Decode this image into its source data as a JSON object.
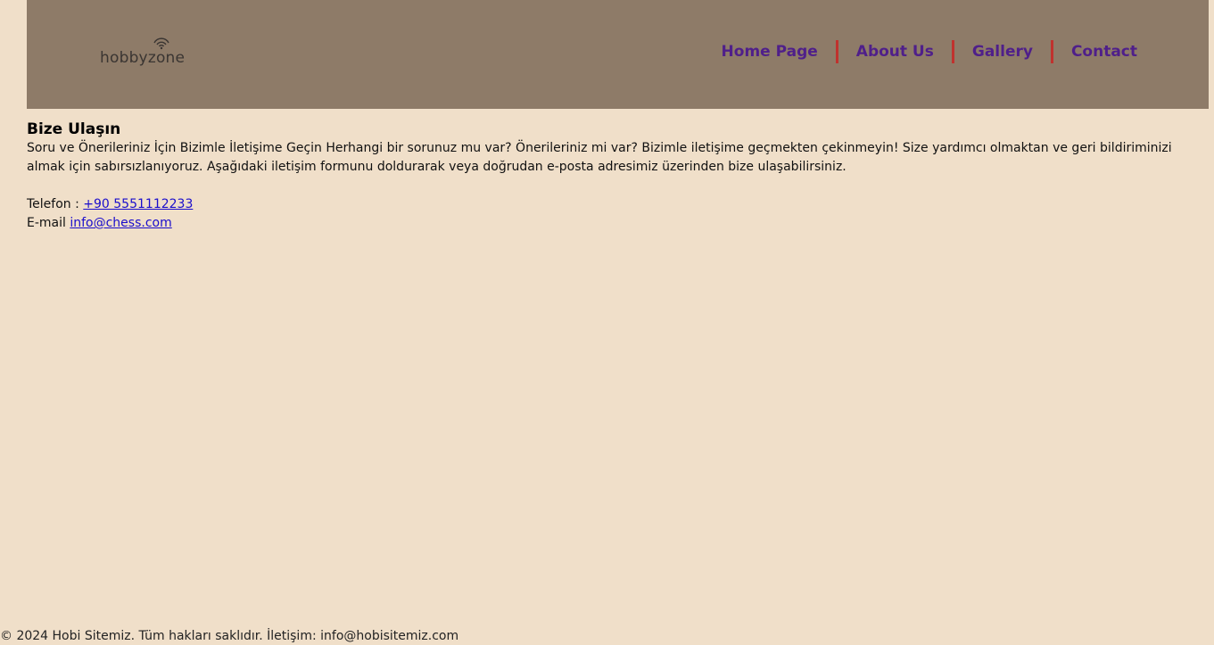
{
  "header": {
    "logo_text": "hobbyzone",
    "nav": [
      {
        "label": "Home Page"
      },
      {
        "label": "About Us"
      },
      {
        "label": "Gallery"
      },
      {
        "label": "Contact"
      }
    ]
  },
  "main": {
    "title": "Bize Ulaşın",
    "paragraph": "Soru ve Önerileriniz İçin Bizimle İletişime Geçin Herhangi bir sorunuz mu var? Önerileriniz mi var? Bizimle iletişime geçmekten çekinmeyin! Size yardımcı olmaktan ve geri bildiriminizi almak için sabırsızlanıyoruz. Aşağıdaki iletişim formunu doldurarak veya doğrudan e-posta adresimiz üzerinden bize ulaşabilirsiniz.",
    "phone_label": "Telefon : ",
    "phone_value": "+90 5551112233",
    "email_label": "E-mail ",
    "email_value": "info@chess.com"
  },
  "footer": {
    "text": "© 2024 Hobi Sitemiz. Tüm hakları saklıdır. İletişim: info@hobisitemiz.com"
  },
  "colors": {
    "page_background": "#f0dfc9",
    "header_background": "#8e7b68",
    "nav_link": "#4f1f8a",
    "nav_separator": "#c0322e",
    "link": "#1a0dcc"
  }
}
